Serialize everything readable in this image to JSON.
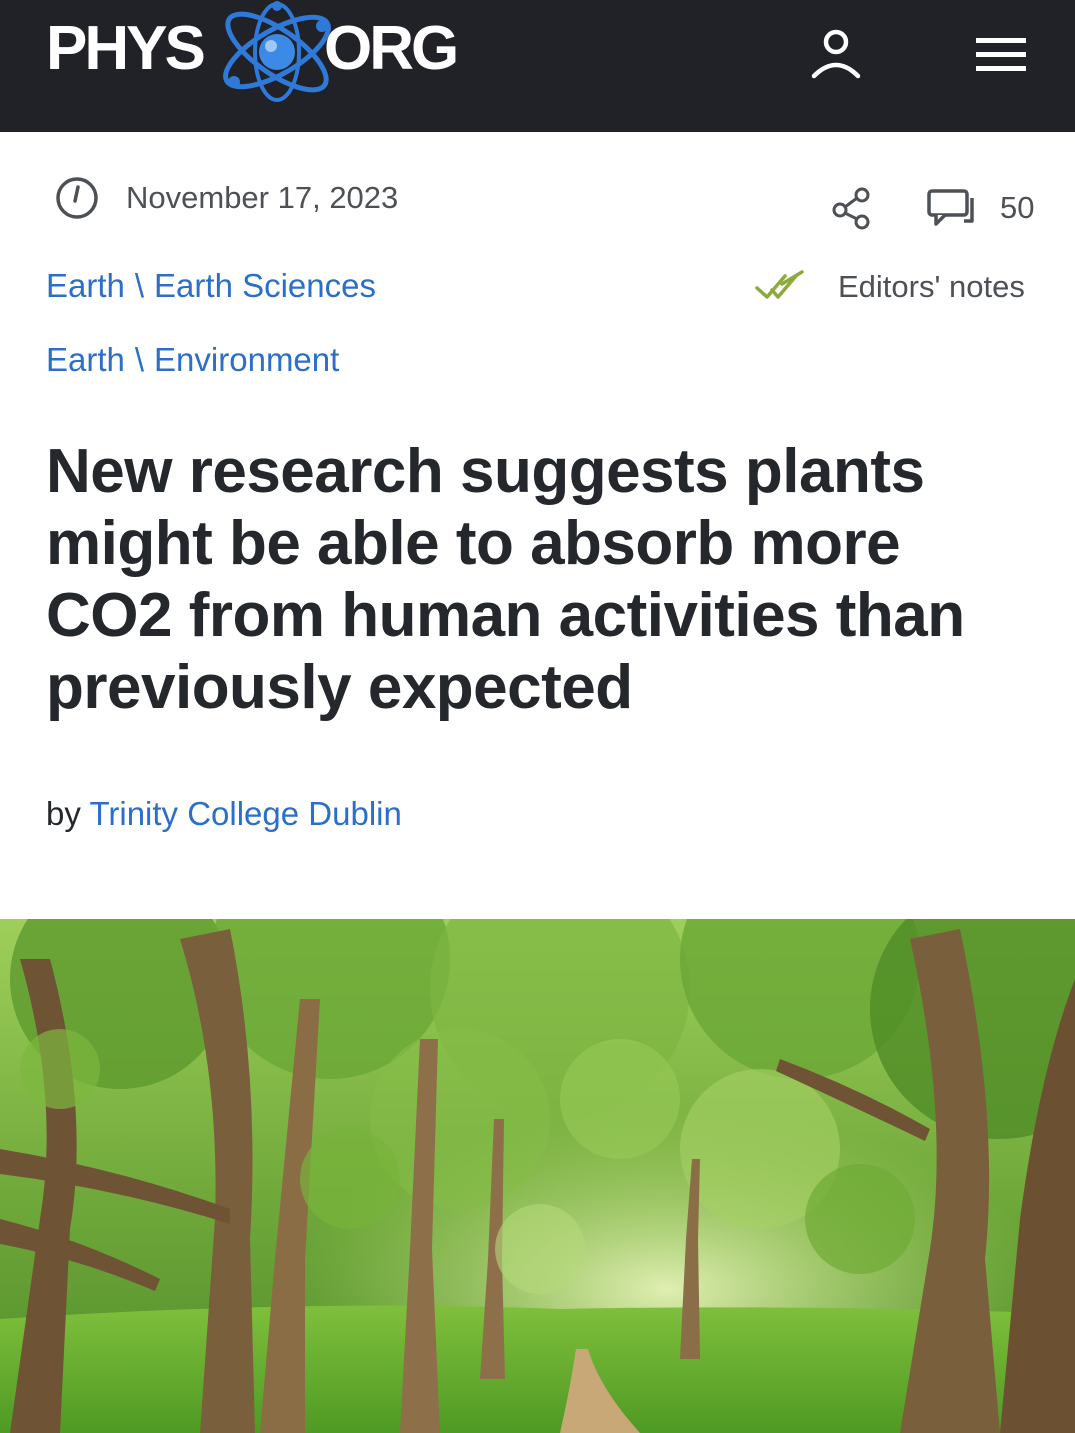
{
  "header": {
    "logo_left": "PHYS",
    "logo_right": "ORG",
    "user_icon": "user-icon",
    "menu_icon": "hamburger-menu-icon",
    "background_color": "#202227",
    "logo_accent_color": "#2f7ad8"
  },
  "article": {
    "date": "November 17, 2023",
    "comment_count": "50",
    "breadcrumbs": [
      {
        "section": "Earth",
        "separator": "\\",
        "subsection": "Earth Sciences"
      },
      {
        "section": "Earth",
        "separator": "\\",
        "subsection": "Environment"
      }
    ],
    "editors_notes_label": "Editors' notes",
    "title": "New research suggests plants might be able to absorb more CO2 from human activities than previously expected",
    "byline_prefix": "by",
    "byline_author": "Trinity College Dublin",
    "link_color": "#2b6fc8",
    "check_color": "#8cab3c"
  }
}
